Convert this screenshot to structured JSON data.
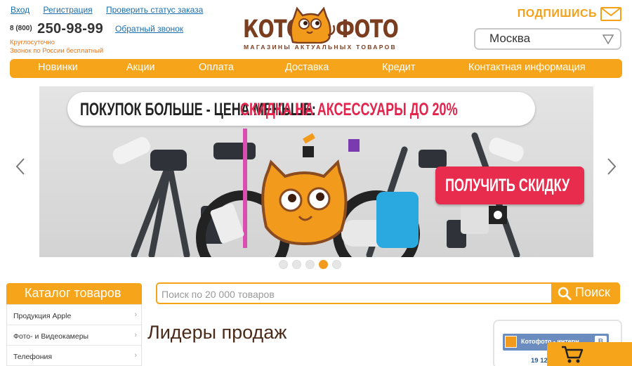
{
  "header": {
    "links": [
      "Вход",
      "Регистрация",
      "Проверить статус заказа"
    ],
    "phone_prefix": "8 (800)",
    "phone_number": "250-98-99",
    "callback_label": "Обратный звонок",
    "phone_note_1": "Круглосуточно",
    "phone_note_2": "Звонок по России бесплатный",
    "logo_left": "КОТО",
    "logo_right": "ФОТО",
    "logo_tagline": "МАГАЗИНЫ АКТУАЛЬНЫХ ТОВАРОВ",
    "subscribe_label": "ПОДПИШИСЬ",
    "city": "Москва"
  },
  "nav": {
    "items": [
      "Новинки",
      "Акции",
      "Оплата",
      "Доставка",
      "Кредит",
      "Контактная информация"
    ]
  },
  "banner": {
    "headline_black": "ПОКУПОК БОЛЬШЕ - ЦЕНА МЕНЬШЕ:",
    "headline_red": "СКИДКА НА АКСЕССУАРЫ ДО 20%",
    "cta_label": "ПОЛУЧИТЬ СКИДКУ",
    "slides_total": 5,
    "active_slide": 4
  },
  "catalog": {
    "title": "Каталог товаров",
    "items": [
      "Продукция Apple",
      "Фото- и Видеокамеры",
      "Телефония"
    ]
  },
  "search": {
    "placeholder": "Поиск по 20 000 товаров",
    "button_label": "Поиск"
  },
  "main": {
    "section_title": "Лидеры продаж"
  },
  "widget": {
    "title": "Котофото - интерн...",
    "vk_label": "В",
    "count_text": "19 12"
  },
  "colors": {
    "accent": "#f6a51b",
    "brand_brown": "#7a3d1f",
    "cta_red": "#e72c4e",
    "link_blue": "#1a6fb0"
  },
  "icons": [
    "envelope-icon",
    "chevron-down-icon",
    "chevron-left-icon",
    "chevron-right-icon",
    "search-icon",
    "cart-icon",
    "cat-logo-icon"
  ]
}
